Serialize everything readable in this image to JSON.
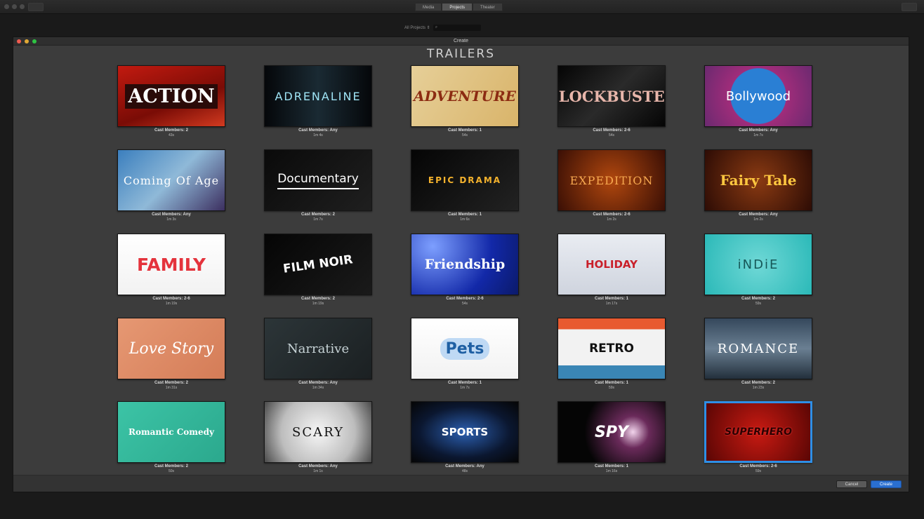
{
  "app": {
    "tabs": [
      "Media",
      "Projects",
      "Theater"
    ],
    "active_tab": "Projects",
    "projects_filter": "All Projects",
    "search_placeholder": ""
  },
  "dialog": {
    "window_title": "Create",
    "heading": "TRAILERS",
    "cancel_label": "Cancel",
    "create_label": "Create",
    "selected": "SUPERHERO",
    "trailers": [
      {
        "title": "ACTION",
        "cast": "Cast Members: 2",
        "duration": "43s"
      },
      {
        "title": "ADRENALINE",
        "cast": "Cast Members: Any",
        "duration": "1m 4s"
      },
      {
        "title": "ADVENTURE",
        "cast": "Cast Members: 1",
        "duration": "54s"
      },
      {
        "title": "BLOCKBUSTER",
        "cast": "Cast Members: 2-6",
        "duration": "54s"
      },
      {
        "title": "Bollywood",
        "cast": "Cast Members: Any",
        "duration": "1m 7s"
      },
      {
        "title": "Coming Of Age",
        "cast": "Cast Members: Any",
        "duration": "1m 3s"
      },
      {
        "title": "Documentary",
        "cast": "Cast Members: 2",
        "duration": "1m 7s"
      },
      {
        "title": "EPIC DRAMA",
        "cast": "Cast Members: 1",
        "duration": "1m 6s"
      },
      {
        "title": "EXPEDITION",
        "cast": "Cast Members: 2-6",
        "duration": "1m 2s"
      },
      {
        "title": "Fairy Tale",
        "cast": "Cast Members: Any",
        "duration": "1m 2s"
      },
      {
        "title": "FAMILY",
        "cast": "Cast Members: 2-6",
        "duration": "1m 19s"
      },
      {
        "title": "FILM NOIR",
        "cast": "Cast Members: 2",
        "duration": "1m 19s"
      },
      {
        "title": "Friendship",
        "cast": "Cast Members: 2-6",
        "duration": "54s"
      },
      {
        "title": "HOLIDAY",
        "cast": "Cast Members: 1",
        "duration": "1m 17s"
      },
      {
        "title": "iNDiE",
        "cast": "Cast Members: 2",
        "duration": "59s"
      },
      {
        "title": "Love Story",
        "cast": "Cast Members: 2",
        "duration": "1m 31s"
      },
      {
        "title": "Narrative",
        "cast": "Cast Members: Any",
        "duration": "1m 34s"
      },
      {
        "title": "Pets",
        "cast": "Cast Members: 1",
        "duration": "1m 7s"
      },
      {
        "title": "RETRO",
        "cast": "Cast Members: 1",
        "duration": "59s"
      },
      {
        "title": "ROMANCE",
        "cast": "Cast Members: 2",
        "duration": "1m 23s"
      },
      {
        "title": "Romantic Comedy",
        "cast": "Cast Members: 2",
        "duration": "50s"
      },
      {
        "title": "SCARY",
        "cast": "Cast Members: Any",
        "duration": "1m 1s"
      },
      {
        "title": "SPORTS",
        "cast": "Cast Members: Any",
        "duration": "48s"
      },
      {
        "title": "SPY",
        "cast": "Cast Members: 1",
        "duration": "1m 16s"
      },
      {
        "title": "SUPERHERO",
        "cast": "Cast Members: 2-6",
        "duration": "59s"
      }
    ]
  }
}
